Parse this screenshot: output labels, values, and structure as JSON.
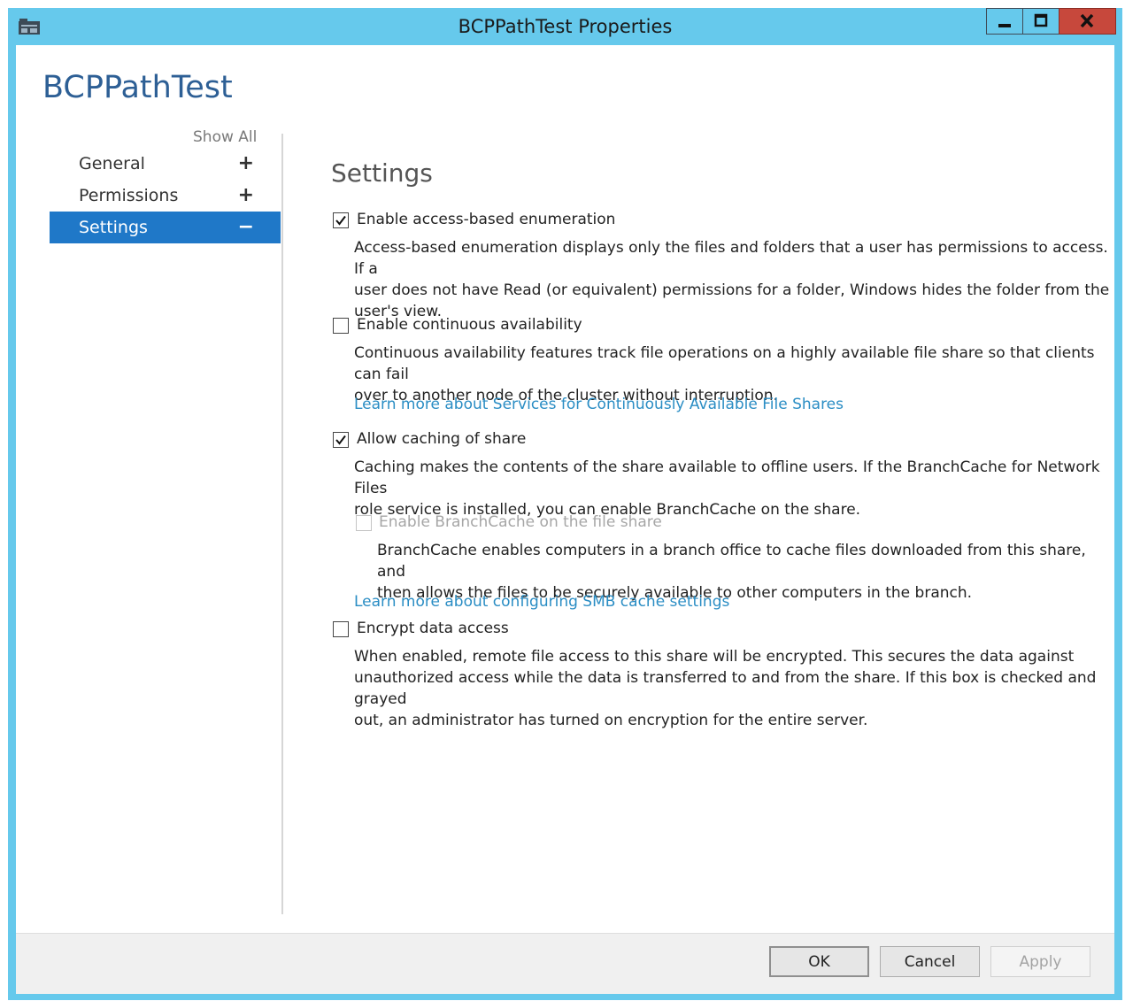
{
  "window": {
    "title": "BCPPathTest Properties",
    "accent_color": "#66c9ec",
    "close_color": "#c7483c"
  },
  "header": {
    "title": "BCPPathTest"
  },
  "nav": {
    "show_all": "Show All",
    "items": [
      {
        "label": "General",
        "sign": "+",
        "selected": false
      },
      {
        "label": "Permissions",
        "sign": "+",
        "selected": false
      },
      {
        "label": "Settings",
        "sign": "−",
        "selected": true
      }
    ],
    "selected_color": "#1f78c8"
  },
  "settings": {
    "title": "Settings",
    "abe": {
      "label": "Enable access-based enumeration",
      "checked": true,
      "desc": [
        "Access-based enumeration displays only the files and folders that a user has permissions to access. If a",
        "user does not have Read (or equivalent) permissions for a folder, Windows hides the folder from the",
        "user's view."
      ]
    },
    "ca": {
      "label": "Enable continuous availability",
      "checked": false,
      "desc": [
        "Continuous availability features track file operations on a highly available file share so that clients can fail",
        "over to another node of the cluster without interruption."
      ],
      "link": "Learn more about Services for Continuously Available File Shares"
    },
    "caching": {
      "label": "Allow caching of share",
      "checked": true,
      "desc": [
        "Caching makes the contents of the share available to offline users. If the BranchCache for Network Files",
        "role service is installed, you can enable BranchCache on the share."
      ]
    },
    "branchcache": {
      "label": "Enable BranchCache on the file share",
      "checked": false,
      "enabled": false,
      "desc": [
        "BranchCache enables computers in a branch office to cache files downloaded from this share, and",
        "then allows the files to be securely available to other computers in the branch."
      ],
      "link": "Learn more about configuring SMB cache settings"
    },
    "encrypt": {
      "label": "Encrypt data access",
      "checked": false,
      "desc": [
        "When enabled, remote file access to this share will be encrypted. This secures the data against",
        "unauthorized access while the data is transferred to and from the share. If this box is checked and grayed",
        "out, an administrator has turned on encryption for the entire server."
      ]
    },
    "link_color": "#2a8dc4"
  },
  "footer": {
    "ok": "OK",
    "cancel": "Cancel",
    "apply": "Apply"
  }
}
